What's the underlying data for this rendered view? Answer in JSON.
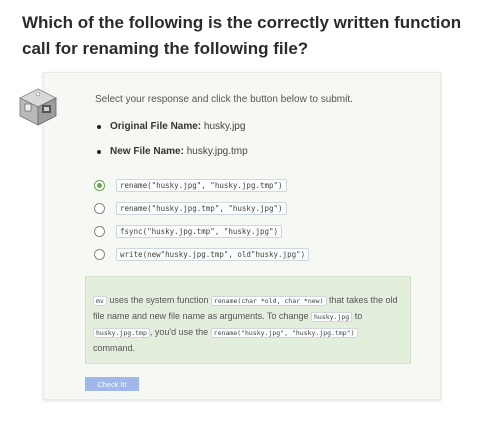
{
  "question": "Which of the following is the correctly written function call for renaming the following file?",
  "instructions": "Select your response and click the button below to submit.",
  "details": [
    {
      "label": "Original File Name:",
      "value": "husky.jpg"
    },
    {
      "label": "New File Name:",
      "value": "husky.jpg.tmp"
    }
  ],
  "options": [
    {
      "text": "rename(\"husky.jpg\", \"husky.jpg.tmp\")",
      "selected": true
    },
    {
      "text": "rename(\"husky.jpg.tmp\", \"husky.jpg\")",
      "selected": false
    },
    {
      "text": "fsync(\"husky.jpg.tmp\", \"husky.jpg\")",
      "selected": false
    },
    {
      "text": "write(new\"husky.jpg.tmp\", old\"husky.jpg\")",
      "selected": false
    }
  ],
  "explanation": {
    "cmd": "mv",
    "t1": "uses the system function",
    "func": "rename(char *old, char *new)",
    "t2": "that takes the old file name and new file name as arguments. To change",
    "from": "husky.jpg",
    "t3": "to",
    "to": "husky.jpg.tmp",
    "t4": ", you'd use the",
    "call": "rename(\"husky.jpg\", \"husky.jpg.tmp\")",
    "t5": "command."
  },
  "button": {
    "label": "Check It!"
  },
  "colors": {
    "accent": "#6aa84f",
    "button": "#9fb7ea",
    "feedback_bg": "#e3eedd"
  }
}
